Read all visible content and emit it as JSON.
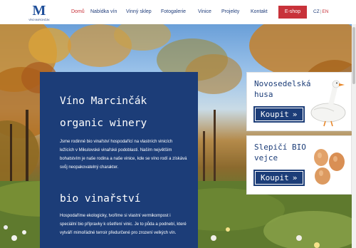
{
  "header": {
    "logo": {
      "letter": "M",
      "tagline": "VÍNO MARCINČÁK"
    },
    "nav": [
      {
        "label": "Domů",
        "active": true
      },
      {
        "label": "Nabídka vín",
        "active": false
      },
      {
        "label": "Vinný sklep",
        "active": false
      },
      {
        "label": "Fotogalerie",
        "active": false
      },
      {
        "label": "Vinice",
        "active": false
      },
      {
        "label": "Projekty",
        "active": false
      },
      {
        "label": "Kontakt",
        "active": false
      }
    ],
    "eshop_label": "E-shop",
    "lang": {
      "cz": "CZ",
      "separator": "|",
      "en": "EN"
    }
  },
  "panel": {
    "title1": "Víno Marcinčák",
    "title2": "organic winery",
    "text1": "Jsme rodinné bio vinařství hospodařící na vlastních vinicích ležících v Mikulovské vinařské podoblasti. Naším největším bohatstvím je naše rodina a naše vinice, kde se víno rodí a získává svůj neopakovatelný charakter.",
    "title3": "bio vinařství",
    "text2": "Hospodaříme ekologicky, tvoříme si vlastní vermikompost i speciální bio přípravky k ošetření vinic. Je to půda a podnebí, které vytváří mimořádné terroir předurčené pro zrození velkých vín."
  },
  "cards": [
    {
      "title": "Novosedelská husa",
      "button": "Koupit",
      "arrow": "»",
      "image_icon": "goose-icon"
    },
    {
      "title": "Slepičí BIO vejce",
      "button": "Koupit",
      "arrow": "»",
      "image_icon": "eggs-icon"
    }
  ],
  "colors": {
    "brand_blue": "#1c3d78",
    "accent_red": "#c8323a"
  }
}
